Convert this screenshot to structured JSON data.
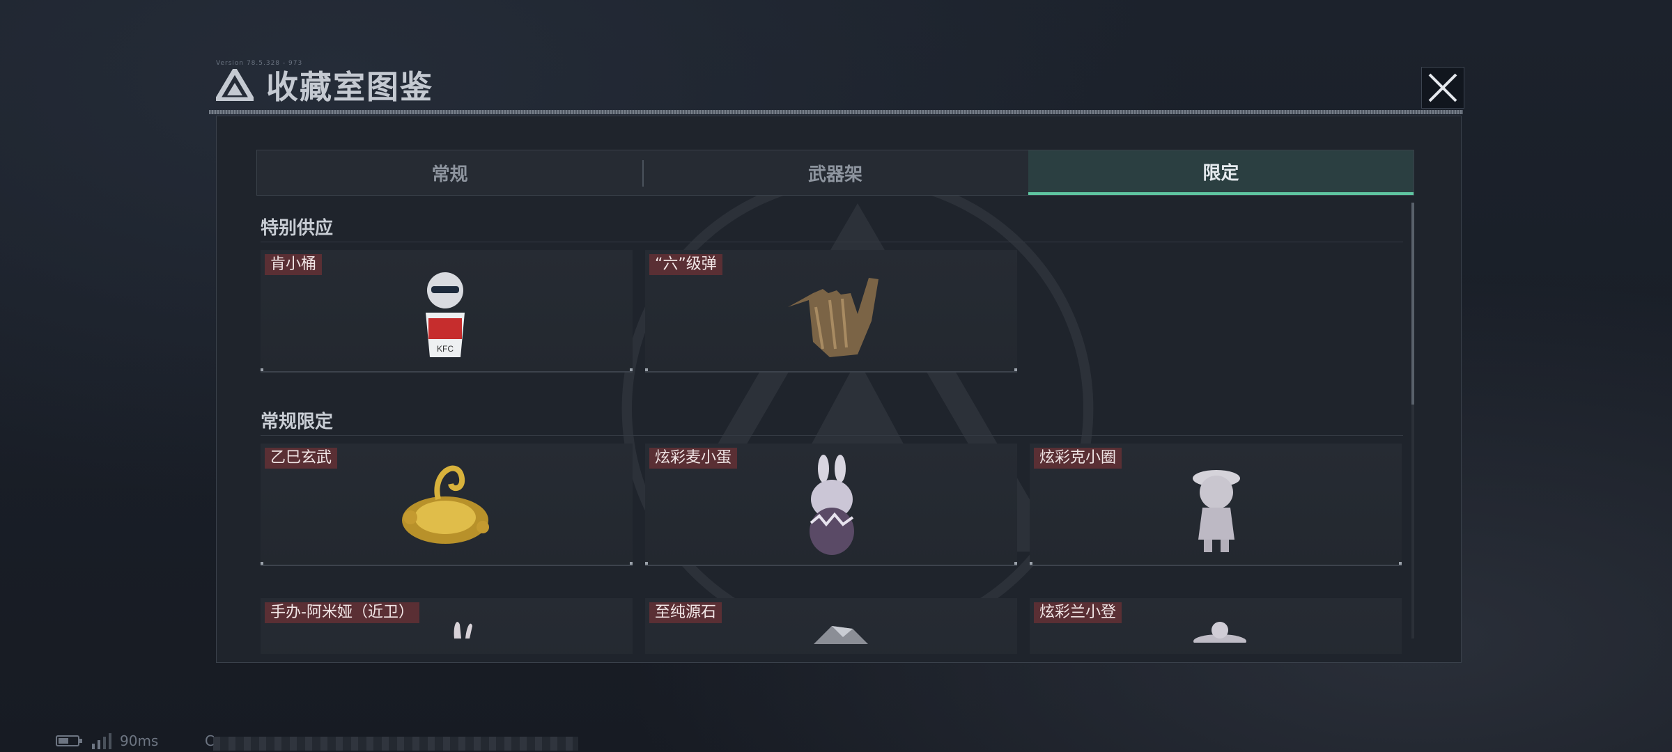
{
  "header": {
    "tiny_caption": "Version 78.5.328 - 973",
    "title": "收藏室图鉴"
  },
  "tabs": [
    {
      "label": "常规",
      "active": false
    },
    {
      "label": "武器架",
      "active": false
    },
    {
      "label": "限定",
      "active": true
    }
  ],
  "sections": [
    {
      "title": "特别供应",
      "items": [
        {
          "label": "肯小桶",
          "icon": "kfc-bucket-figure-icon"
        },
        {
          "label": "“六”级弹",
          "icon": "bullet-hand-sculpture-icon"
        }
      ]
    },
    {
      "title": "常规限定",
      "items": [
        {
          "label": "乙巳玄武",
          "icon": "golden-turtle-snake-icon"
        },
        {
          "label": "炫彩麦小蛋",
          "icon": "rabbit-egg-figure-icon"
        },
        {
          "label": "炫彩克小圈",
          "icon": "hat-girl-figure-icon"
        },
        {
          "label": "手办-阿米娅（近卫）",
          "icon": "amiya-figure-icon"
        },
        {
          "label": "至纯源石",
          "icon": "originium-crystal-icon"
        },
        {
          "label": "炫彩兰小登",
          "icon": "figure-icon"
        }
      ]
    }
  ],
  "status": {
    "latency": "90ms",
    "prefix": "C"
  },
  "colors": {
    "accent": "#5fc5a1",
    "label_bg": "#5a2f34",
    "panel_bg": "#1f242c"
  }
}
